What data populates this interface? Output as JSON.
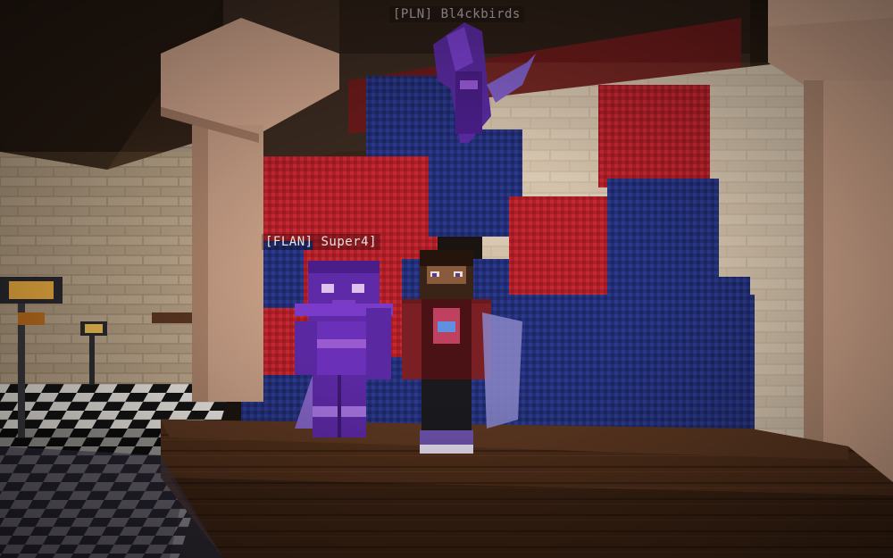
{
  "nametags": {
    "top_player": "[PLN] Bl4ckbirds",
    "front_player": "[FLAN] Super4]"
  },
  "colors": {
    "wool_red": "#b8202a",
    "wool_blue": "#23307a",
    "stone_brick": "#c9b9a4",
    "wood_stage": "#4a2a18",
    "pillar": "#c99e86",
    "ceiling": "#2a1c12"
  }
}
